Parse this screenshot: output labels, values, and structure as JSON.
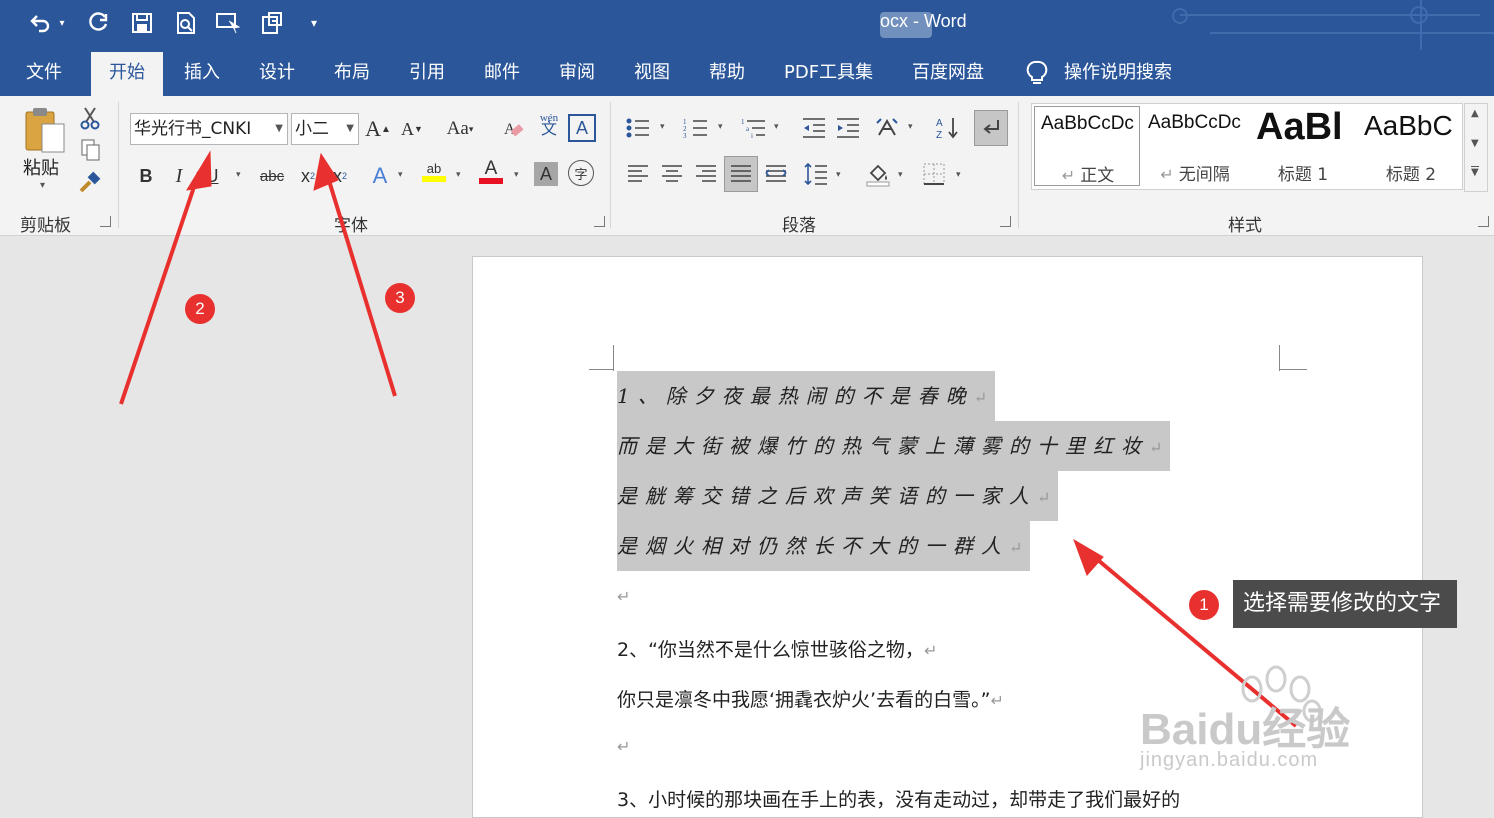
{
  "titlebar": {
    "title": "ocx - Word",
    "quick_access": [
      "undo",
      "redo",
      "save",
      "print-preview",
      "touch-mode",
      "customize"
    ]
  },
  "tabs": [
    "文件",
    "开始",
    "插入",
    "设计",
    "布局",
    "引用",
    "邮件",
    "审阅",
    "视图",
    "帮助",
    "PDF工具集",
    "百度网盘"
  ],
  "active_tab": "开始",
  "tell_me": "操作说明搜索",
  "ribbon": {
    "clipboard": {
      "paste_label": "粘贴",
      "group_label": "剪贴板"
    },
    "font": {
      "font_name": "华光行书_CNKI",
      "font_size": "小二",
      "group_label": "字体",
      "grow": "A",
      "shrink": "A",
      "case": "Aa",
      "phonetic": "wén",
      "phonetic_char": "文",
      "bold": "B",
      "italic": "I",
      "underline": "U",
      "strike": "abc",
      "subscript": "x",
      "superscript": "x",
      "highlight": "ab",
      "font_color": "A",
      "shading": "A",
      "enclose": "字",
      "border_char": "A"
    },
    "paragraph": {
      "group_label": "段落"
    },
    "styles": {
      "group_label": "样式",
      "items": [
        {
          "sample": "AaBbCcDc",
          "name": "正文"
        },
        {
          "sample": "AaBbCcDc",
          "name": "无间隔"
        },
        {
          "sample": "AaBl",
          "name": "标题 1"
        },
        {
          "sample": "AaBbC",
          "name": "标题 2"
        }
      ]
    }
  },
  "document": {
    "selected_lines": [
      "1、除夕夜最热闹的不是春晚",
      "而是大街被爆竹的热气蒙上薄雾的十里红妆",
      "是觥筹交错之后欢声笑语的一家人",
      "是烟火相对仍然长不大的一群人"
    ],
    "paragraphs": [
      "",
      "2、“你当然不是什么惊世骇俗之物，",
      "你只是凛冬中我愿‘拥毳衣炉火’去看的白雪。”",
      "",
      "3、小时候的那块画在手上的表，没有走动过，却带走了我们最好的"
    ],
    "mark": "↵"
  },
  "annotations": {
    "badges": [
      "1",
      "2",
      "3"
    ],
    "tooltip": "选择需要修改的文字",
    "arrow_color": "#e8312f"
  },
  "watermark": {
    "brand": "Baidu经验",
    "url": "jingyan.baidu.com"
  },
  "colors": {
    "brand": "#2b579a",
    "highlight_yellow": "#ffff00",
    "font_red": "#e81123",
    "selection": "#c8c8c8"
  }
}
